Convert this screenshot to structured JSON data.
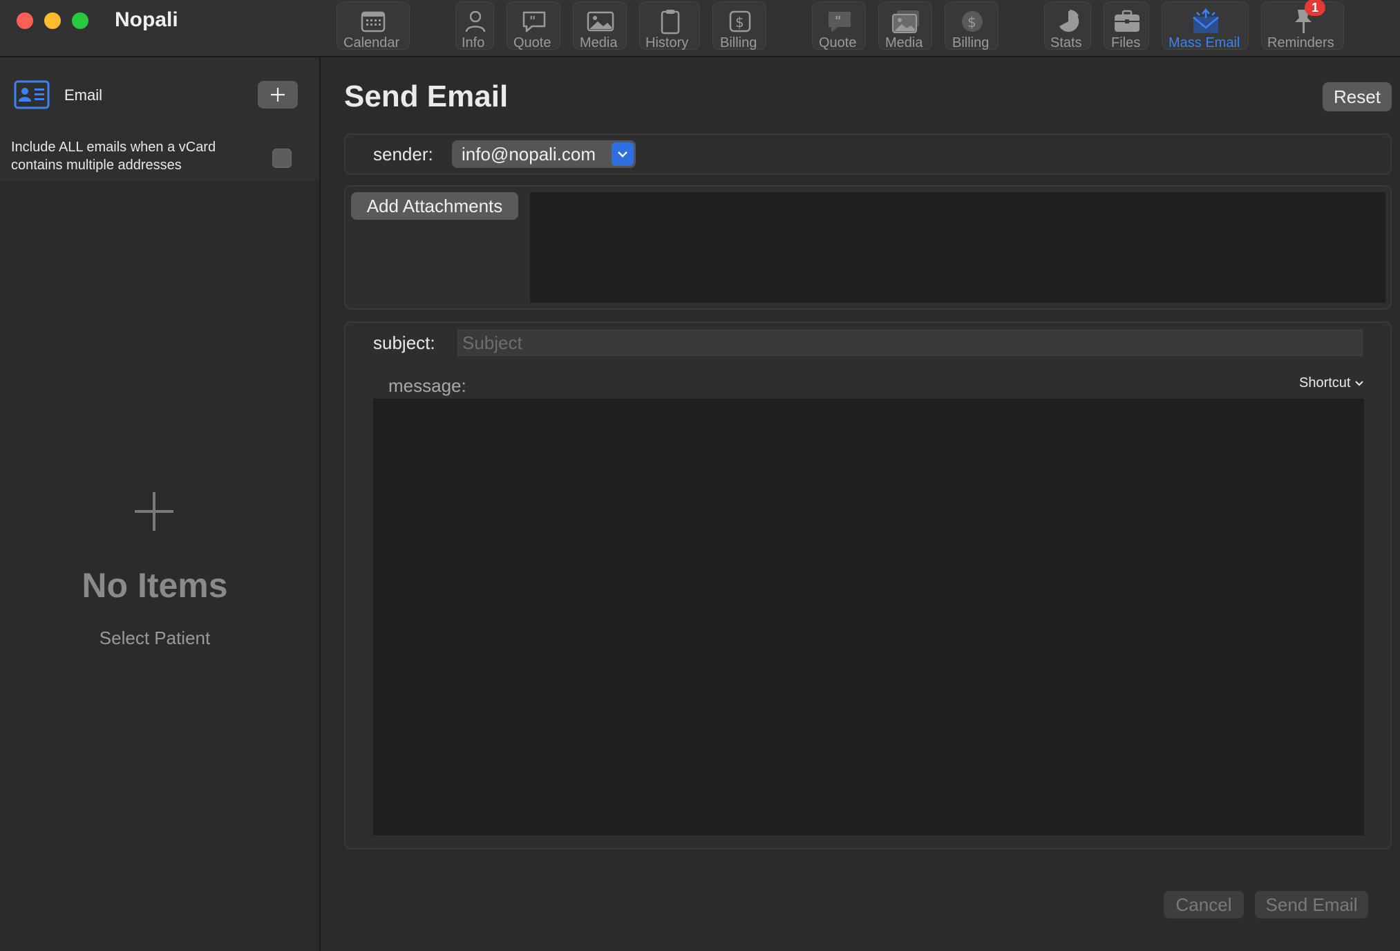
{
  "app": {
    "title": "Nopali"
  },
  "toolbar": {
    "items": [
      {
        "label": "Calendar",
        "icon": "calendar-icon"
      },
      {
        "label": "Info",
        "icon": "person-icon"
      },
      {
        "label": "Quote",
        "icon": "quote-bubble-icon"
      },
      {
        "label": "Media",
        "icon": "photo-icon"
      },
      {
        "label": "History",
        "icon": "clipboard-icon"
      },
      {
        "label": "Billing",
        "icon": "dollar-icon"
      },
      {
        "label": "Quote",
        "icon": "quote-bubble-icon"
      },
      {
        "label": "Media",
        "icon": "photos-stack-icon"
      },
      {
        "label": "Billing",
        "icon": "dollar-circle-icon"
      },
      {
        "label": "Stats",
        "icon": "pie-chart-icon"
      },
      {
        "label": "Files",
        "icon": "briefcase-icon"
      },
      {
        "label": "Mass Email",
        "icon": "envelope-icon",
        "active": true
      },
      {
        "label": "Reminders",
        "icon": "pin-icon",
        "badge": "1"
      }
    ],
    "active_color": "#3b82f6"
  },
  "sidebar": {
    "header_label": "Email",
    "include_all_text": "Include ALL emails when a vCard contains multiple addresses",
    "empty_title": "No Items",
    "empty_subtitle": "Select Patient"
  },
  "main": {
    "title": "Send Email",
    "reset_label": "Reset",
    "sender_label": "sender:",
    "sender_value": "info@nopali.com",
    "add_attachments_label": "Add Attachments",
    "subject_label": "subject:",
    "subject_placeholder": "Subject",
    "message_label": "message:",
    "shortcut_label": "Shortcut",
    "cancel_label": "Cancel",
    "send_label": "Send Email"
  }
}
